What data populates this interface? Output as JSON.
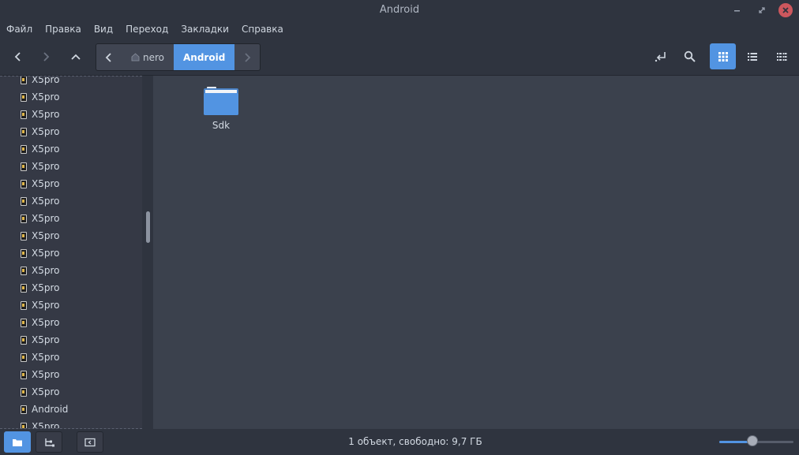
{
  "window": {
    "title": "Android"
  },
  "menu": [
    "Файл",
    "Правка",
    "Вид",
    "Переход",
    "Закладки",
    "Справка"
  ],
  "pathbar": {
    "segments": [
      {
        "label": "nero",
        "icon": "home-icon"
      },
      {
        "label": "Android"
      }
    ]
  },
  "sidebar": {
    "items": [
      "X5pro",
      "X5pro",
      "X5pro",
      "X5pro",
      "X5pro",
      "X5pro",
      "X5pro",
      "X5pro",
      "X5pro",
      "X5pro",
      "X5pro",
      "X5pro",
      "X5pro",
      "X5pro",
      "X5pro",
      "X5pro",
      "X5pro",
      "X5pro",
      "X5pro",
      "Android",
      "X5pro"
    ]
  },
  "files": [
    {
      "name": "Sdk",
      "icon": "folder-icon"
    }
  ],
  "status": {
    "text": "1 объект, свободно: 9,7 ГБ",
    "zoom": 0.45
  },
  "colors": {
    "accent": "#5294e2",
    "close": "#cc575d",
    "folder": "#5294e2"
  }
}
